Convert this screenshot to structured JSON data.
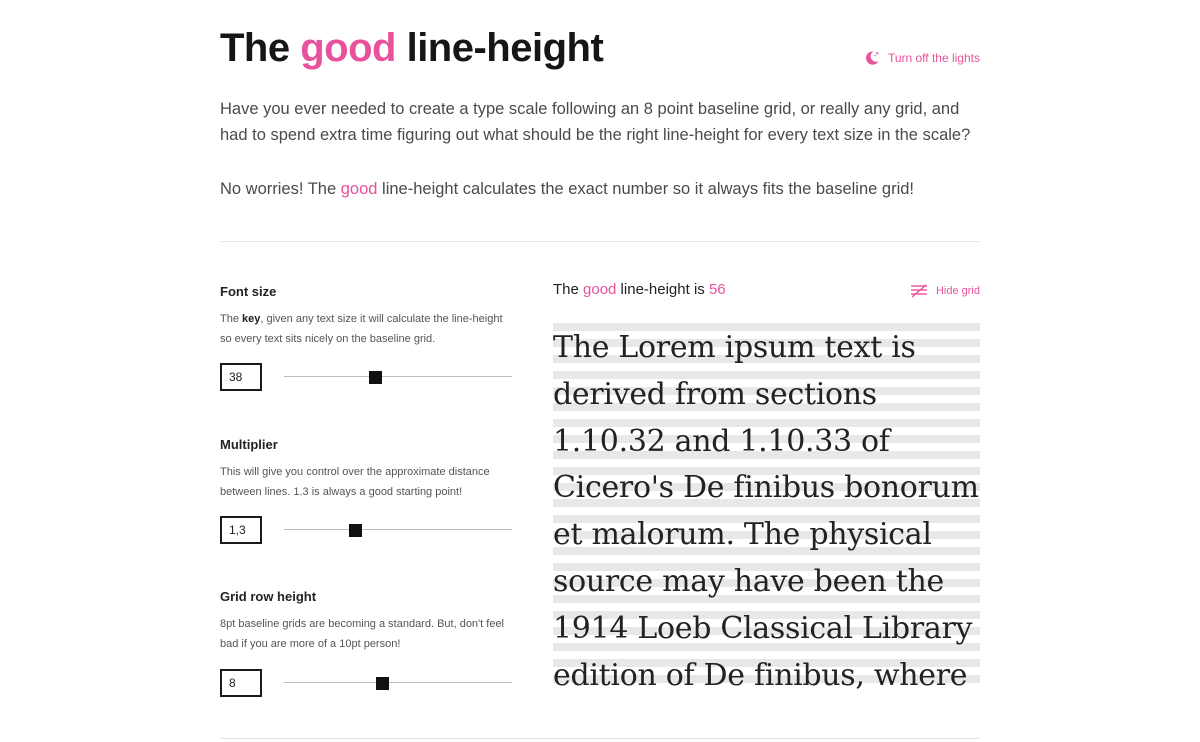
{
  "header": {
    "title_pre": "The ",
    "title_accent": "good",
    "title_post": " line-height",
    "lights_label": "Turn off the lights"
  },
  "intro": {
    "paragraph1": "Have you ever needed to create a type scale following an 8 point baseline grid, or really any grid, and had to spend extra time figuring out what should be the right line-height for every text size in the scale?",
    "paragraph2_pre": "No worries! The ",
    "paragraph2_accent": "good",
    "paragraph2_post": " line-height calculates the exact number so it always fits the baseline grid!"
  },
  "controls": {
    "font_size": {
      "label": "Font size",
      "desc_key": "key",
      "desc_pre": "The ",
      "desc_post": ", given any text size it will calculate the line-height so every text sits nicely on the baseline grid.",
      "value": "38",
      "slider_fraction": 0.4
    },
    "multiplier": {
      "label": "Multiplier",
      "desc": "This will give you control over the approximate distance between lines. 1.3 is always a good starting point!",
      "value": "1,3",
      "slider_fraction": 0.31
    },
    "grid_row_height": {
      "label": "Grid row height",
      "desc": "8pt baseline grids are becoming a standard. But, don't feel bad if you are more of a 10pt person!",
      "value": "8",
      "slider_fraction": 0.43
    }
  },
  "result": {
    "pre": "The ",
    "accent": "good",
    "post": " line-height is ",
    "value": "56",
    "hide_grid_label": "Hide grid",
    "sample_text": "The Lorem ipsum text is derived from sections 1.10.32 and 1.10.33 of Cicero's De finibus bonorum et malorum. The physical source may have been the 1914 Loeb Classical Library edition of De finibus, where"
  },
  "icons": {
    "lights": "moon-icon",
    "grid": "grid-lines-icon"
  },
  "colors": {
    "accent": "#e8519b",
    "text": "#161616",
    "grid_stripe": "#e8e8e8"
  }
}
